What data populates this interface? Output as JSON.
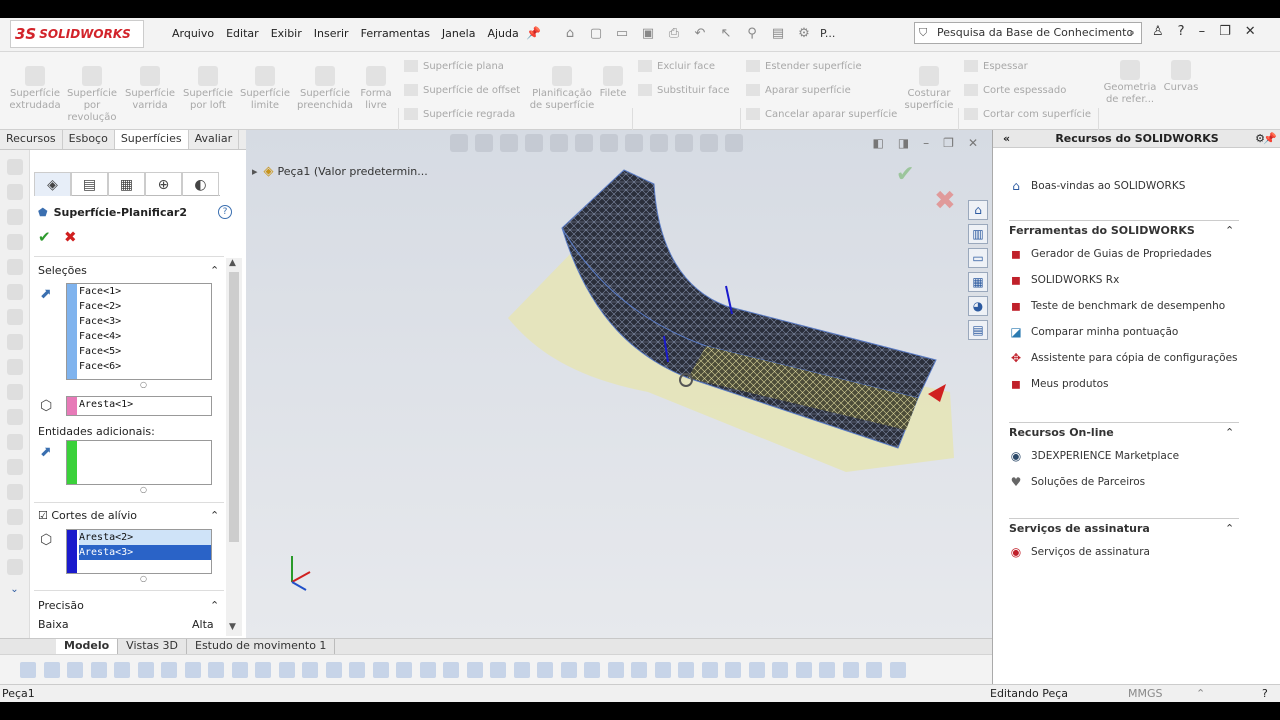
{
  "app": {
    "logo_ds": "3S",
    "logo_name": "SOLIDWORKS"
  },
  "menu": [
    "Arquivo",
    "Editar",
    "Exibir",
    "Inserir",
    "Ferramentas",
    "Janela",
    "Ajuda"
  ],
  "toolbar_overflow": "P...",
  "search": {
    "placeholder": "Pesquisa da Base de Conhecimento"
  },
  "ribbon": {
    "big": [
      {
        "label": "Superfície extrudada"
      },
      {
        "label": "Superfície por revolução"
      },
      {
        "label": "Superfície varrida"
      },
      {
        "label": "Superfície por loft"
      },
      {
        "label": "Superfície limite"
      },
      {
        "label": "Superfície preenchida"
      },
      {
        "label": "Forma livre"
      }
    ],
    "col1": [
      "Superfície plana",
      "Superfície de offset",
      "Superfície regrada"
    ],
    "planif": "Planificação de superfície",
    "filete": "Filete",
    "col2": [
      "Excluir face",
      "Substituir face"
    ],
    "col3": [
      "Estender superfície",
      "Aparar superfície",
      "Cancelar aparar superfície"
    ],
    "costurar": "Costurar superfície",
    "col4": [
      "Espessar",
      "Corte espessado",
      "Cortar com superfície"
    ],
    "geom": "Geometria de refer...",
    "curvas": "Curvas"
  },
  "left_tabs": [
    "Recursos",
    "Esboço",
    "Superfícies",
    "Avaliar"
  ],
  "property": {
    "title": "Superfície-Planificar2",
    "help": "?",
    "ok": "✔",
    "cancel": "✖",
    "selecoes": "Seleções",
    "faces": [
      "Face<1>",
      "Face<2>",
      "Face<3>",
      "Face<4>",
      "Face<5>",
      "Face<6>"
    ],
    "aresta": "Aresta<1>",
    "entidades": "Entidades adicionais:",
    "cortes": "Cortes de alívio",
    "cortes_items": [
      "Aresta<2>",
      "Aresta<3>"
    ],
    "precisao": "Precisão",
    "baixa": "Baixa",
    "alta": "Alta"
  },
  "viewport": {
    "tree": "Peça1  (Valor predetermin..."
  },
  "bottom_tabs": [
    "Modelo",
    "Vistas 3D",
    "Estudo de movimento 1"
  ],
  "status": {
    "doc": "Peça1",
    "mode": "Editando Peça",
    "units": "MMGS"
  },
  "resources": {
    "title": "Recursos do SOLIDWORKS",
    "welcome": "Boas-vindas ao SOLIDWORKS",
    "tools_title": "Ferramentas do SOLIDWORKS",
    "tools": [
      "Gerador de Guias de Propriedades",
      "SOLIDWORKS Rx",
      "Teste de benchmark de desempenho",
      "Comparar minha pontuação",
      "Assistente para cópia de configurações",
      "Meus produtos"
    ],
    "online_title": "Recursos On-line",
    "online": [
      "3DEXPERIENCE Marketplace",
      "Soluções de Parceiros"
    ],
    "subs_title": "Serviços de assinatura",
    "subs": [
      "Serviços de assinatura"
    ]
  },
  "colors": {
    "accent": "#d2232a",
    "select_blue": "#2a63c7",
    "mesh": "#2a2e3a",
    "flat": "#e6e4b8"
  }
}
